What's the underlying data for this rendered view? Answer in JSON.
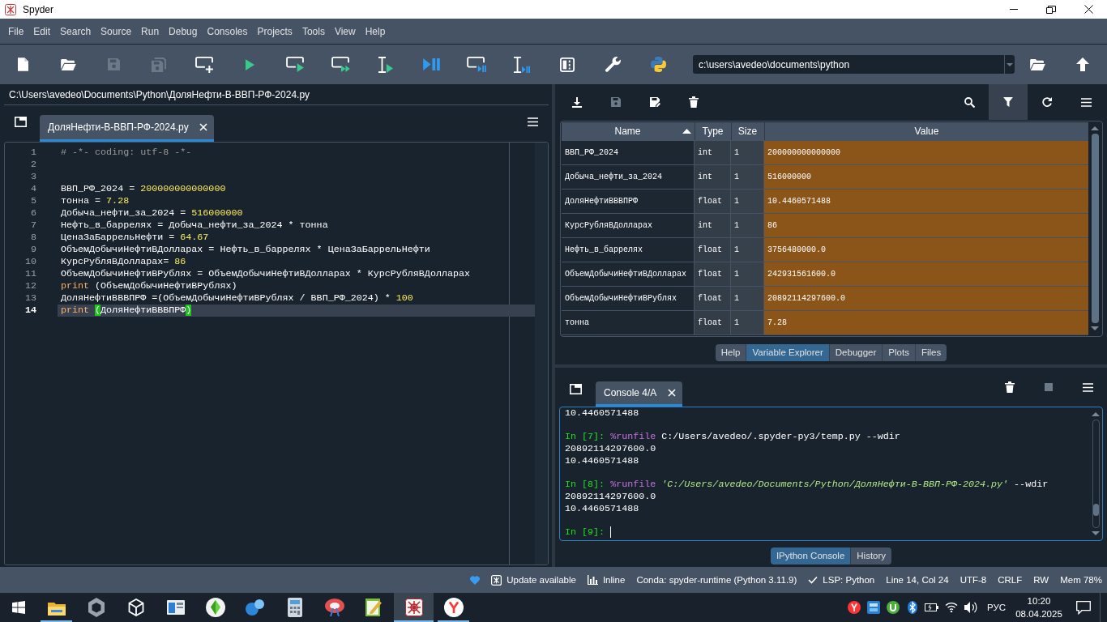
{
  "window": {
    "title": "Spyder"
  },
  "menu": [
    "File",
    "Edit",
    "Search",
    "Source",
    "Run",
    "Debug",
    "Consoles",
    "Projects",
    "Tools",
    "View",
    "Help"
  ],
  "toolbar": {
    "buttons": [
      {
        "kind": "new",
        "disabled": false
      },
      {
        "kind": "open",
        "disabled": false
      },
      {
        "kind": "save",
        "disabled": true
      },
      {
        "kind": "saveall",
        "disabled": true
      },
      {
        "kind": "cell",
        "disabled": false
      },
      {
        "kind": "run",
        "disabled": false
      },
      {
        "kind": "runcell",
        "disabled": false
      },
      {
        "kind": "runnext",
        "disabled": false
      },
      {
        "kind": "runselection",
        "disabled": false
      },
      {
        "kind": "debug",
        "disabled": false
      },
      {
        "kind": "debugcell",
        "disabled": false
      },
      {
        "kind": "debugselection",
        "disabled": false
      },
      {
        "kind": "maximize",
        "disabled": false
      },
      {
        "kind": "preferences",
        "disabled": false
      },
      {
        "kind": "pythonpath",
        "disabled": false
      }
    ],
    "working_directory": "c:\\users\\avedeo\\documents\\python"
  },
  "editor": {
    "file_path": "C:\\Users\\avedeo\\Documents\\Python\\ДоляНефти-В-ВВП-РФ-2024.py",
    "tabs": [
      {
        "label": "ДоляНефти-В-ВВП-РФ-2024.py",
        "selected": true
      }
    ],
    "lines": [
      {
        "number": "1",
        "current": false,
        "tokens": [
          {
            "kind": "comment",
            "text": "# -*- coding: utf-8 -*-"
          }
        ]
      },
      {
        "number": "2",
        "current": false
      },
      {
        "number": "3",
        "current": false
      },
      {
        "number": "4",
        "current": false,
        "tokens": [
          {
            "kind": "plain",
            "text": "ВВП_РФ_2024 = "
          },
          {
            "kind": "number",
            "text": "200000000000000"
          }
        ]
      },
      {
        "number": "5",
        "current": false,
        "tokens": [
          {
            "kind": "plain",
            "text": "тонна = "
          },
          {
            "kind": "number",
            "text": "7.28"
          }
        ]
      },
      {
        "number": "6",
        "current": false,
        "tokens": [
          {
            "kind": "plain",
            "text": "Добыча_нефти_за_2024 = "
          },
          {
            "kind": "number",
            "text": "516000000"
          }
        ]
      },
      {
        "number": "7",
        "current": false,
        "tokens": [
          {
            "kind": "plain",
            "text": "Нефть_в_баррелях = Добыча_нефти_за_2024 * тонна"
          }
        ]
      },
      {
        "number": "8",
        "current": false,
        "tokens": [
          {
            "kind": "plain",
            "text": "ЦенаЗаБаррельНефти = "
          },
          {
            "kind": "number",
            "text": "64.67"
          }
        ]
      },
      {
        "number": "9",
        "current": false,
        "tokens": [
          {
            "kind": "plain",
            "text": "ОбъемДобычиНефтиВДолларах = Нефть_в_баррелях * ЦенаЗаБаррельНефти"
          }
        ]
      },
      {
        "number": "10",
        "current": false,
        "tokens": [
          {
            "kind": "plain",
            "text": "КурсРубляВДолларах= "
          },
          {
            "kind": "number",
            "text": "86"
          }
        ]
      },
      {
        "number": "11",
        "current": false,
        "tokens": [
          {
            "kind": "plain",
            "text": "ОбъемДобычиНефтиВРублях = ОбъемДобычиНефтиВДолларах * КурсРубляВДолларах"
          }
        ]
      },
      {
        "number": "12",
        "current": false,
        "tokens": [
          {
            "kind": "builtin",
            "text": "print"
          },
          {
            "kind": "plain",
            "text": " (ОбъемДобычиНефтиВРублях)"
          }
        ]
      },
      {
        "number": "13",
        "current": false,
        "tokens": [
          {
            "kind": "plain",
            "text": "ДоляНефтиВВВПРФ =(ОбъемДобычиНефтиВРублях / ВВП_РФ_2024) * "
          },
          {
            "kind": "number",
            "text": "100"
          }
        ]
      },
      {
        "number": "14",
        "current": true,
        "tokens": [
          {
            "kind": "builtin",
            "text": "print "
          },
          {
            "kind": "bracket",
            "text": "("
          },
          {
            "kind": "plain",
            "text": "ДоляНефтиВВВПРФ"
          },
          {
            "kind": "bracket",
            "text": ")"
          }
        ]
      }
    ]
  },
  "variable_explorer": {
    "toolbar_left": [
      {
        "kind": "import",
        "disabled": false,
        "on": false
      },
      {
        "kind": "save",
        "disabled": true,
        "on": false
      },
      {
        "kind": "saveas",
        "disabled": false,
        "on": false
      },
      {
        "kind": "remove",
        "disabled": false,
        "on": false
      }
    ],
    "toolbar_right": [
      {
        "kind": "search",
        "disabled": false,
        "on": false
      },
      {
        "kind": "filter",
        "disabled": false,
        "on": true
      },
      {
        "kind": "refresh",
        "disabled": false,
        "on": false
      },
      {
        "kind": "options",
        "disabled": false,
        "on": false
      }
    ],
    "columns": [
      {
        "label": "Name",
        "sorted": true
      },
      {
        "label": "Type",
        "sorted": false
      },
      {
        "label": "Size",
        "sorted": false
      },
      {
        "label": "Value",
        "sorted": false
      }
    ],
    "rows": [
      {
        "name": "ВВП_РФ_2024",
        "type": "int",
        "size": "1",
        "value": "200000000000000"
      },
      {
        "name": "Добыча_нефти_за_2024",
        "type": "int",
        "size": "1",
        "value": "516000000"
      },
      {
        "name": "ДоляНефтиВВВПРФ",
        "type": "float",
        "size": "1",
        "value": "10.4460571488"
      },
      {
        "name": "КурсРубляВДолларах",
        "type": "int",
        "size": "1",
        "value": "86"
      },
      {
        "name": "Нефть_в_баррелях",
        "type": "float",
        "size": "1",
        "value": "3756480000.0"
      },
      {
        "name": "ОбъемДобычиНефтиВДолларах",
        "type": "float",
        "size": "1",
        "value": "242931561600.0"
      },
      {
        "name": "ОбъемДобычиНефтиВРублях",
        "type": "float",
        "size": "1",
        "value": "20892114297600.0"
      },
      {
        "name": "тонна",
        "type": "float",
        "size": "1",
        "value": "7.28"
      }
    ],
    "dock_tabs": [
      {
        "label": "Help",
        "selected": false
      },
      {
        "label": "Variable Explorer",
        "selected": true
      },
      {
        "label": "Debugger",
        "selected": false
      },
      {
        "label": "Plots",
        "selected": false
      },
      {
        "label": "Files",
        "selected": false
      }
    ]
  },
  "console": {
    "tabs": [
      {
        "label": "Console 4/A",
        "selected": true
      }
    ],
    "toolbar": [
      {
        "kind": "remove",
        "disabled": false
      },
      {
        "kind": "stop",
        "disabled": true
      },
      {
        "kind": "options",
        "disabled": false
      }
    ],
    "entries": [
      {
        "output": [
          "10.4460571488"
        ]
      },
      {
        "prompt": "In [7]:",
        "tokens": [
          {
            "kind": "magic",
            "text": "%runfile"
          },
          {
            "kind": "plain",
            "text": " C:/Users/avedeo/.spyder-py3/temp.py --wdir"
          }
        ],
        "output": [
          "20892114297600.0",
          "10.4460571488"
        ]
      },
      {
        "prompt": "In [8]:",
        "tokens": [
          {
            "kind": "magic",
            "text": "%runfile "
          },
          {
            "kind": "string",
            "text": "'C:/Users/avedeo/Documents/Python/ДоляНефти-В-ВВП-РФ-2024.py'"
          },
          {
            "kind": "plain",
            "text": " --wdir"
          }
        ],
        "output": [
          "20892114297600.0",
          "10.4460571488"
        ]
      },
      {
        "prompt": "In [9]:"
      }
    ],
    "dock_tabs": [
      {
        "label": "IPython Console",
        "selected": true
      },
      {
        "label": "History",
        "selected": false
      }
    ]
  },
  "status_bar": {
    "update": "Update available",
    "backend": "Inline",
    "conda": "Conda: spyder-runtime (Python 3.11.9)",
    "lsp": "LSP: Python",
    "cursor_position": "Line 14, Col 24",
    "encoding": "UTF-8",
    "eol": "CRLF",
    "permissions": "RW",
    "memory": "Mem 78%"
  },
  "taskbar": {
    "apps": [
      {
        "kind": "folder",
        "running": true,
        "selected": false
      },
      {
        "kind": "hexagon",
        "running": false,
        "selected": false
      },
      {
        "kind": "cube",
        "running": false,
        "selected": false
      },
      {
        "kind": "panel",
        "running": false,
        "selected": false
      },
      {
        "kind": "gem",
        "running": false,
        "selected": false
      },
      {
        "kind": "bubbles",
        "running": false,
        "selected": false
      },
      {
        "kind": "calculator",
        "running": false,
        "selected": false
      },
      {
        "kind": "ring",
        "running": false,
        "selected": false
      },
      {
        "kind": "notepad",
        "running": false,
        "selected": false
      },
      {
        "kind": "web",
        "running": true,
        "selected": true
      },
      {
        "kind": "logo",
        "running": true,
        "selected": false
      }
    ],
    "language": "РУС",
    "time": "10:20",
    "date": "08.04.2025"
  }
}
